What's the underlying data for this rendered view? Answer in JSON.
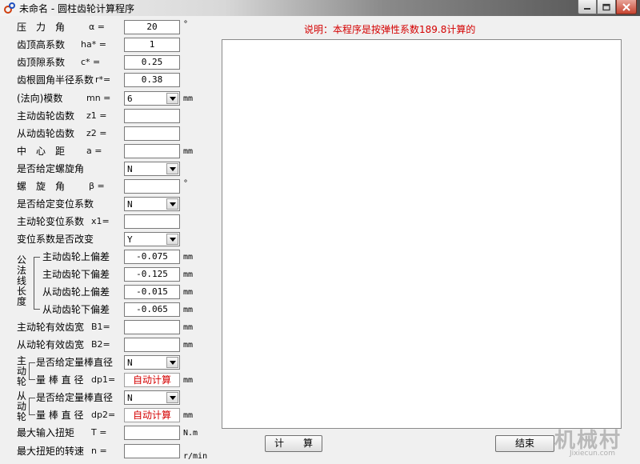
{
  "window": {
    "title": "未命名 - 圆柱齿轮计算程序"
  },
  "note": "说明：本程序是按弹性系数189.8计算的",
  "params": {
    "pressure_angle": {
      "label": "压　力　角",
      "symbol": "α =",
      "value": "20",
      "unit": "°"
    },
    "addendum_coef": {
      "label": "齿顶高系数",
      "symbol": "ha* =",
      "value": "1"
    },
    "clearance_coef": {
      "label": "齿顶隙系数",
      "symbol": "c* =",
      "value": "0.25"
    },
    "root_radius_coef": {
      "label": "齿根圆角半径系数",
      "symbol": "r*=",
      "value": "0.38"
    },
    "normal_module": {
      "label": "(法向)模数",
      "symbol": "mn =",
      "selected": "6",
      "unit": "mm"
    },
    "driving_teeth": {
      "label": "主动齿轮齿数",
      "symbol": "z1 =",
      "value": ""
    },
    "driven_teeth": {
      "label": "从动齿轮齿数",
      "symbol": "z2 =",
      "value": ""
    },
    "center_distance": {
      "label": "中　心　距",
      "symbol": "a =",
      "value": "",
      "unit": "mm"
    },
    "given_helix": {
      "label": "是否给定螺旋角",
      "selected": "N"
    },
    "helix_angle": {
      "label": "螺　旋　角",
      "symbol": "β =",
      "value": "",
      "unit": "°"
    },
    "given_shift": {
      "label": "是否给定变位系数",
      "selected": "N"
    },
    "driving_shift": {
      "label": "主动轮变位系数",
      "symbol": "x1=",
      "value": ""
    },
    "shift_change": {
      "label": "变位系数是否改变",
      "selected": "Y"
    }
  },
  "normal_length": {
    "group_label": [
      "公",
      "法",
      "线",
      "长",
      "度"
    ],
    "rows": [
      {
        "label": "主动齿轮上偏差",
        "value": "-0.075",
        "unit": "mm"
      },
      {
        "label": "主动齿轮下偏差",
        "value": "-0.125",
        "unit": "mm"
      },
      {
        "label": "从动齿轮上偏差",
        "value": "-0.015",
        "unit": "mm"
      },
      {
        "label": "从动齿轮下偏差",
        "value": "-0.065",
        "unit": "mm"
      }
    ]
  },
  "face_width": {
    "driving": {
      "label": "主动轮有效齿宽",
      "symbol": "B1=",
      "value": "",
      "unit": "mm"
    },
    "driven": {
      "label": "从动轮有效齿宽",
      "symbol": "B2=",
      "value": "",
      "unit": "mm"
    }
  },
  "driving_rod": {
    "group_label": [
      "主",
      "动",
      "轮"
    ],
    "given": {
      "label": "是否给定量棒直径",
      "selected": "N"
    },
    "diameter": {
      "label": "量 棒 直 径",
      "symbol": "dp1=",
      "value": "自动计算",
      "unit": "mm"
    }
  },
  "driven_rod": {
    "group_label": [
      "从",
      "动",
      "轮"
    ],
    "given": {
      "label": "是否给定量棒直径",
      "selected": "N"
    },
    "diameter": {
      "label": "量 棒 直 径",
      "symbol": "dp2=",
      "value": "自动计算",
      "unit": "mm"
    }
  },
  "torque": {
    "label": "最大输入扭矩",
    "symbol": "T =",
    "value": "",
    "unit": "N.m"
  },
  "speed": {
    "label": "最大扭矩的转速",
    "symbol": "n =",
    "value": "",
    "unit": "r/min"
  },
  "buttons": {
    "calculate": "计　　算",
    "finish": "结束"
  },
  "watermark": {
    "main": "机械村",
    "sub": "Jixiecun.com"
  },
  "colors": {
    "note_red": "#d40000",
    "auto_red": "#d40000"
  }
}
